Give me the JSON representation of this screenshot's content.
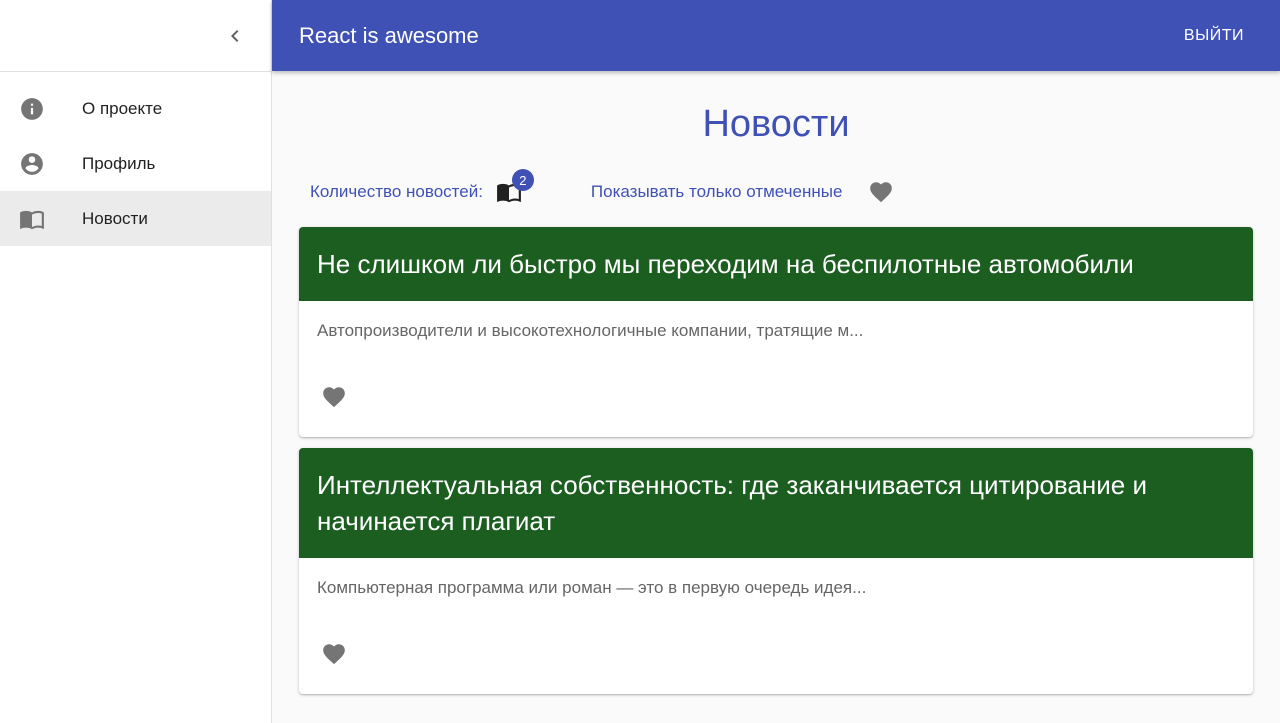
{
  "app": {
    "title": "React is awesome",
    "logout_label": "ВЫЙТИ"
  },
  "sidebar": {
    "collapse_icon": "chevron-left-icon",
    "items": [
      {
        "label": "О проекте",
        "icon": "info-icon",
        "active": false
      },
      {
        "label": "Профиль",
        "icon": "account-circle-icon",
        "active": false
      },
      {
        "label": "Новости",
        "icon": "book-open-icon",
        "active": true
      }
    ]
  },
  "page": {
    "title": "Новости"
  },
  "filters": {
    "count_label": "Количество новостей:",
    "count_value": "2",
    "only_marked_label": "Показывать только отмеченные"
  },
  "news": [
    {
      "title": "Не слишком ли быстро мы переходим на беспилотные автомобили",
      "excerpt": "Автопроизводители и высокотехнологичные компании, тратящие м..."
    },
    {
      "title": "Интеллектуальная собственность: где заканчивается цитирование и начинается плагиат",
      "excerpt": "Компьютерная программа или роман — это в первую очередь идея..."
    }
  ],
  "colors": {
    "primary": "#3f51b5",
    "card_header": "#1b5e20",
    "icon_gray": "#757575",
    "active_item_bg": "#ebebeb"
  }
}
